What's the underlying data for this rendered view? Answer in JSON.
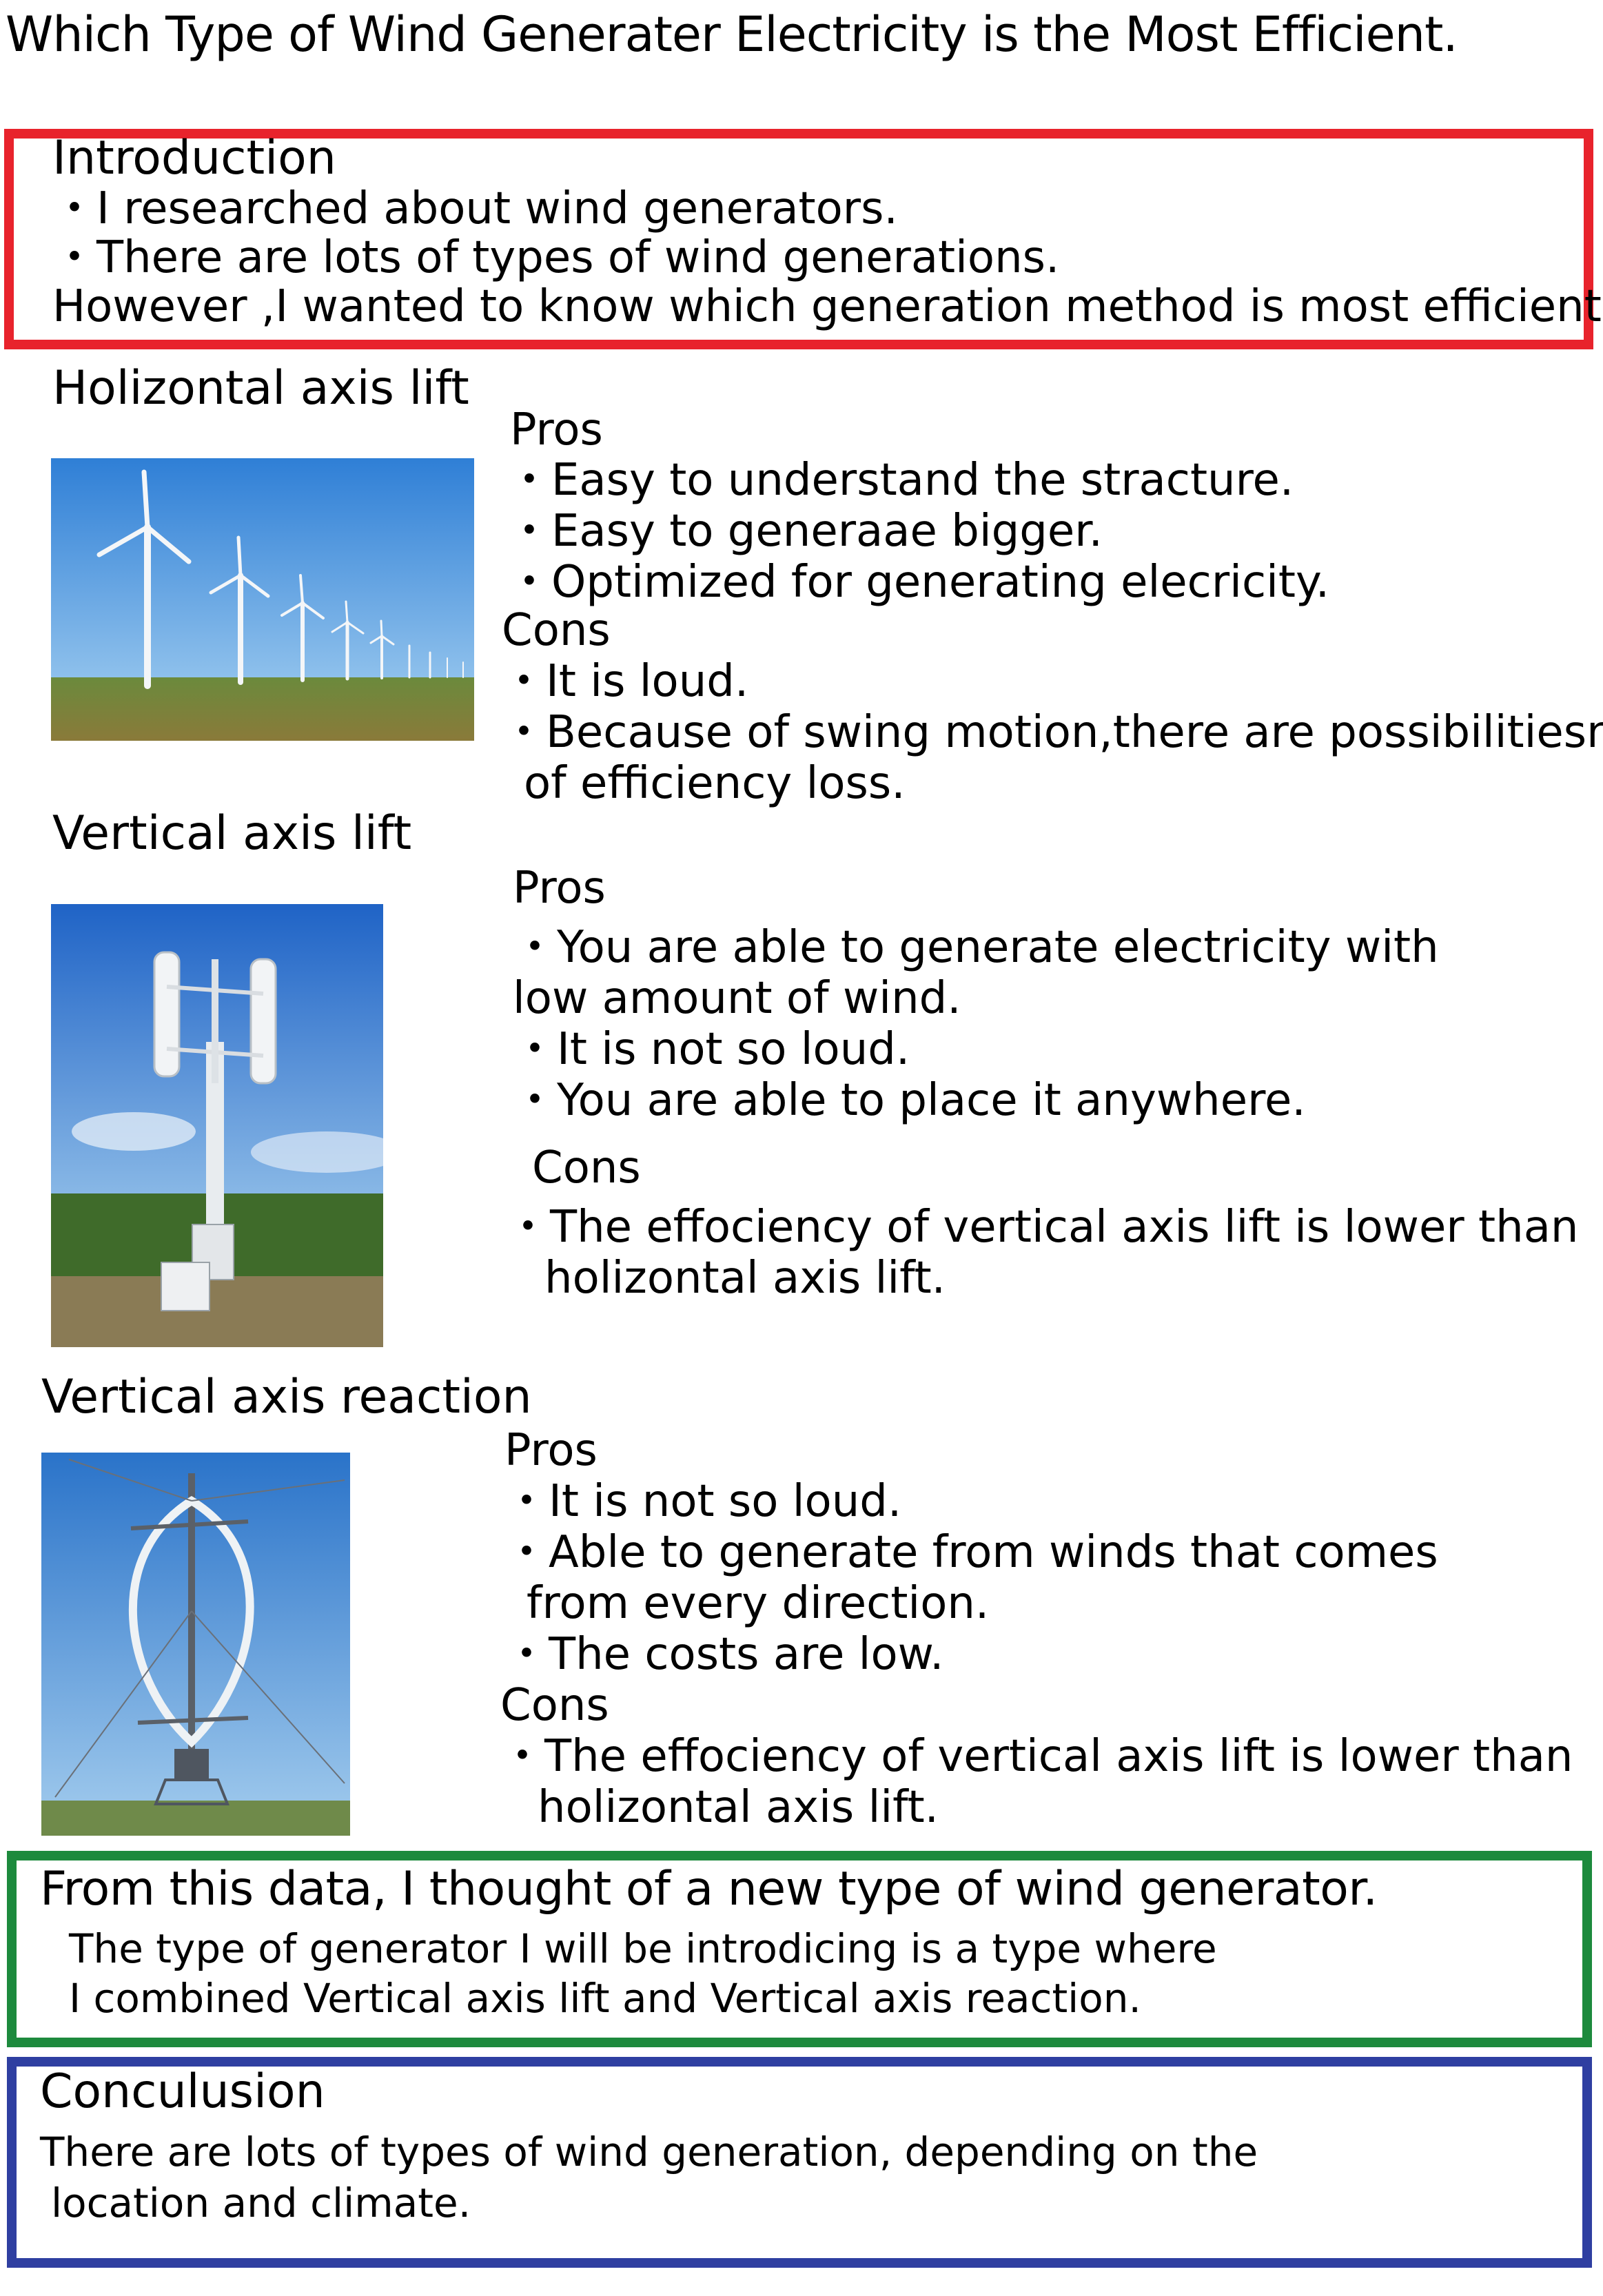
{
  "title": "Which Type of Wind Generater Electricity is the Most Efficient.",
  "intro": {
    "heading": "Introduction",
    "lines": [
      "・I researched about wind generators.",
      "・There are lots of types of wind generations.",
      "However ,I wanted to know which generation method is most efficient."
    ]
  },
  "horizontal": {
    "heading": "Holizontal axis lift",
    "pros_label": "Pros",
    "pros": [
      "・Easy to understand the stracture.",
      "・Easy to generaae bigger.",
      "・Optimized for generating elecricity."
    ],
    "cons_label": "Cons",
    "cons": [
      "・It is loud.",
      "・Because of swing motion,there are possibilitiesn",
      "of efficiency loss."
    ]
  },
  "vertical_lift": {
    "heading": "Vertical axis lift",
    "pros_label": "Pros",
    "pros": [
      "・You are able to generate electricity with",
      "low amount of wind.",
      "・It is not so loud.",
      "・You are able to place it anywhere."
    ],
    "cons_label": "Cons",
    "cons": [
      "・The effociency of vertical axis lift is lower than",
      "holizontal axis lift."
    ]
  },
  "vertical_reaction": {
    "heading": "Vertical axis reaction",
    "pros_label": "Pros",
    "pros": [
      "・It is not so loud.",
      "・Able to generate from winds that comes",
      "from every direction.",
      "・The costs are low."
    ],
    "cons_label": "Cons",
    "cons": [
      "・The effociency of vertical axis lift is lower than",
      "holizontal axis lift."
    ]
  },
  "new_type": {
    "heading": "From this data, I thought of a new type of wind generator.",
    "lines": [
      "The type of generator I will be introdicing is a type where",
      "I combined Vertical axis lift and Vertical axis reaction."
    ]
  },
  "conclusion": {
    "heading": "Conculusion",
    "lines": [
      "There are lots of types of wind generation, depending on the",
      "location and climate."
    ]
  },
  "colors": {
    "intro_border": "#e8232c",
    "new_type_border": "#1d8a3d",
    "conclusion_border": "#2f3fa1"
  }
}
